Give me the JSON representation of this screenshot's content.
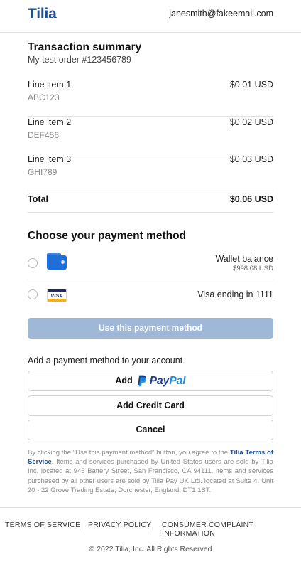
{
  "header": {
    "logo": "Tilia",
    "email": "janesmith@fakeemail.com"
  },
  "summary": {
    "title": "Transaction summary",
    "order": "My test order #123456789",
    "items": [
      {
        "name": "Line item 1",
        "sku": "ABC123",
        "price": "$0.01 USD"
      },
      {
        "name": "Line item 2",
        "sku": "DEF456",
        "price": "$0.02 USD"
      },
      {
        "name": "Line item 3",
        "sku": "GHI789",
        "price": "$0.03 USD"
      }
    ],
    "total_label": "Total",
    "total_value": "$0.06 USD"
  },
  "payment": {
    "title": "Choose your payment method",
    "options": [
      {
        "icon": "wallet-icon",
        "label": "Wallet balance",
        "sublabel": "$998.08 USD"
      },
      {
        "icon": "visa-card-icon",
        "label": "Visa ending in 1111",
        "card_brand": "VISA"
      }
    ],
    "use_button": "Use this payment method"
  },
  "add_method": {
    "label": "Add a payment method to your account",
    "paypal_prefix": "Add",
    "paypal_pay": "Pay",
    "paypal_pal": "Pal",
    "credit_card": "Add Credit Card",
    "cancel": "Cancel"
  },
  "legal": {
    "before_link": "By clicking the \"Use this payment method\" button, you agree to the ",
    "link": "Tilia Terms of Service",
    "after_link": ". Items and services purchased by United States users are sold by Tilia Inc. located at 945 Battery Street, San Francisco, CA 94111. Items and services purchased by all other users are sold by Tilia Pay UK Ltd. located at Suite 4, Unit 20 - 22 Grove Trading Estate, Dorchester, England, DT1 1ST."
  },
  "footer": {
    "links": [
      "TERMS OF SERVICE",
      "PRIVACY POLICY",
      "CONSUMER COMPLAINT INFORMATION"
    ],
    "copyright": "© 2022 Tilia, Inc. All Rights Reserved"
  },
  "colors": {
    "brand": "#1d4f91",
    "button_disabled": "#9fb8d8",
    "paypal_dark": "#1d3f8c",
    "paypal_light": "#1f8ed9"
  }
}
